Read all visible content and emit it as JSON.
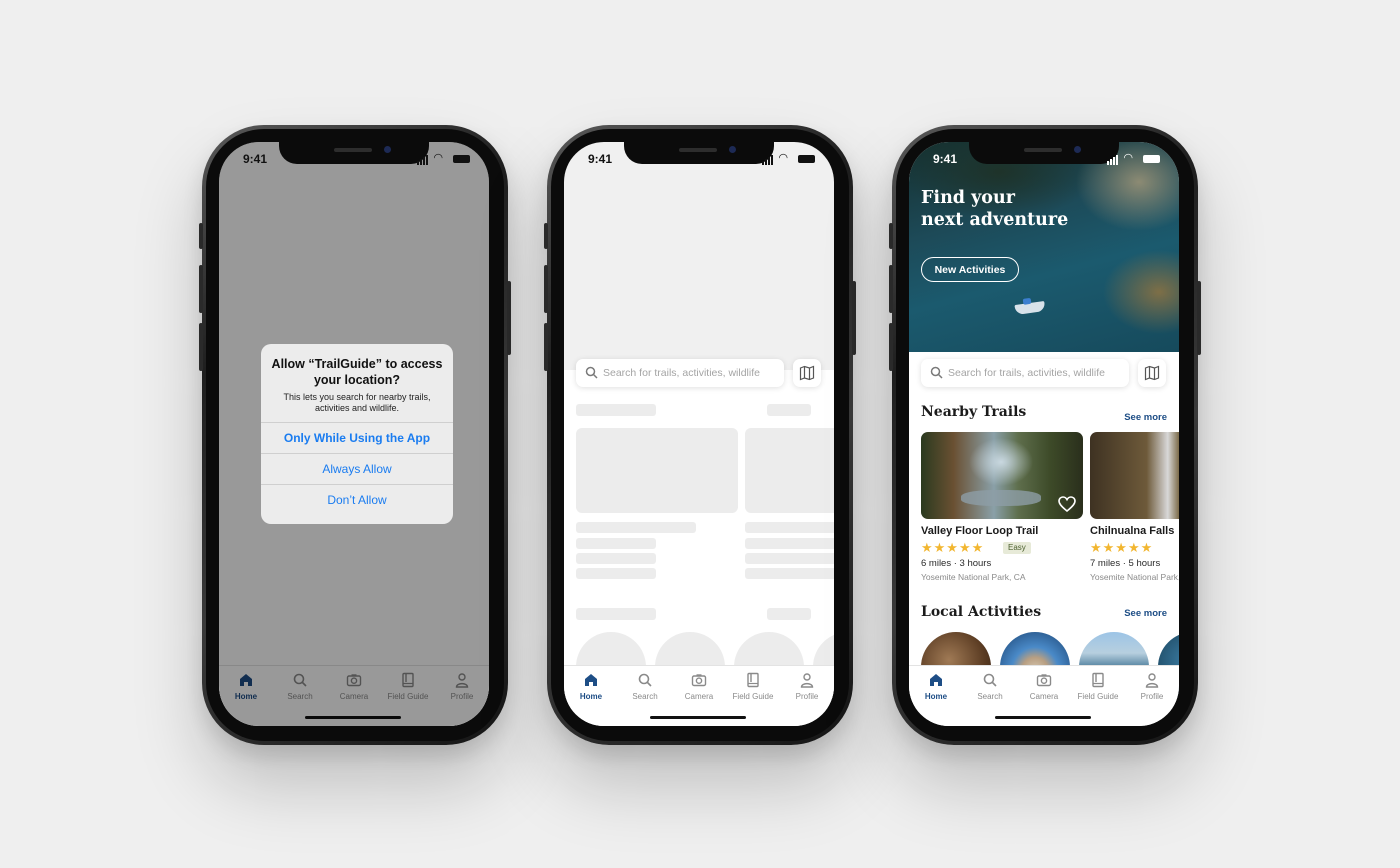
{
  "status_bar": {
    "time": "9:41"
  },
  "tabs": [
    {
      "label": "Home",
      "icon": "home-icon",
      "active": true
    },
    {
      "label": "Search",
      "icon": "search-icon",
      "active": false
    },
    {
      "label": "Camera",
      "icon": "camera-icon",
      "active": false
    },
    {
      "label": "Field Guide",
      "icon": "book-icon",
      "active": false
    },
    {
      "label": "Profile",
      "icon": "person-icon",
      "active": false
    }
  ],
  "alert": {
    "title": "Allow “TrailGuide” to access your location?",
    "message": "This lets you search for nearby trails, activities and wildlife.",
    "buttons": [
      "Only While Using the App",
      "Always Allow",
      "Don’t Allow"
    ]
  },
  "search": {
    "placeholder": "Search for trails, activities, wildlife"
  },
  "hero": {
    "title_line1": "Find your",
    "title_line2": "next adventure",
    "button": "New Activities"
  },
  "nearby": {
    "title": "Nearby Trails",
    "see_more": "See more",
    "cards": [
      {
        "name": "Valley Floor Loop Trail",
        "rating": 5,
        "difficulty": "Easy",
        "meta": "6 miles · 3 hours",
        "location": "Yosemite National Park, CA"
      },
      {
        "name": "Chilnualna Falls",
        "rating": 5,
        "difficulty": "",
        "meta": "7 miles · 5 hours",
        "location": "Yosemite National Park, CA"
      }
    ]
  },
  "activities": {
    "title": "Local Activities",
    "see_more": "See more"
  },
  "colors": {
    "accent": "#1e4e86",
    "ios_blue": "#1a7cf0",
    "star": "#f2b630",
    "background": "#efefef"
  }
}
